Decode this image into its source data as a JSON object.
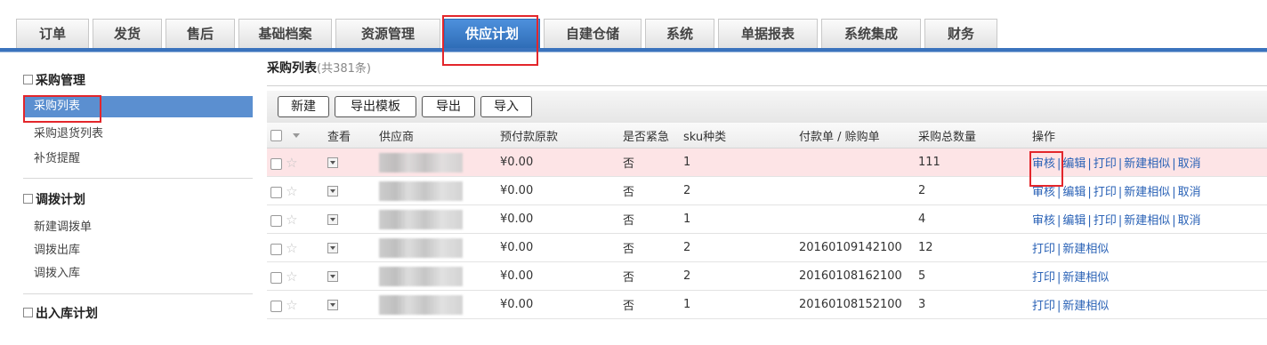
{
  "nav": {
    "tabs": [
      {
        "label": "订单"
      },
      {
        "label": "发货"
      },
      {
        "label": "售后"
      },
      {
        "label": "基础档案"
      },
      {
        "label": "资源管理"
      },
      {
        "label": "供应计划"
      },
      {
        "label": "自建仓储"
      },
      {
        "label": "系统"
      },
      {
        "label": "单据报表"
      },
      {
        "label": "系统集成"
      },
      {
        "label": "财务"
      }
    ],
    "active_tab": "供应计划"
  },
  "sidebar": {
    "sections": [
      {
        "title": "采购管理",
        "items": [
          "采购列表",
          "采购退货列表",
          "补货提醒"
        ]
      },
      {
        "title": "调拨计划",
        "items": [
          "新建调拨单",
          "调拨出库",
          "调拨入库"
        ]
      },
      {
        "title": "出入库计划",
        "items": []
      }
    ],
    "active_item": "采购列表"
  },
  "main": {
    "title": "采购列表",
    "count": "(共381条)",
    "toolbar": {
      "new": "新建",
      "export_template": "导出模板",
      "export": "导出",
      "import": "导入"
    },
    "columns": [
      "查看",
      "供应商",
      "预付款原款",
      "是否紧急",
      "sku种类",
      "付款单 / 赊购单",
      "采购总数量",
      "操作"
    ],
    "rows": [
      {
        "amount": "¥0.00",
        "urgent": "否",
        "sku": "1",
        "payment": "",
        "qty": "111",
        "ops": [
          "审核",
          "编辑",
          "打印",
          "新建相似",
          "取消"
        ]
      },
      {
        "amount": "¥0.00",
        "urgent": "否",
        "sku": "2",
        "payment": "",
        "qty": "2",
        "ops": [
          "审核",
          "编辑",
          "打印",
          "新建相似",
          "取消"
        ]
      },
      {
        "amount": "¥0.00",
        "urgent": "否",
        "sku": "1",
        "payment": "",
        "qty": "4",
        "ops": [
          "审核",
          "编辑",
          "打印",
          "新建相似",
          "取消"
        ]
      },
      {
        "amount": "¥0.00",
        "urgent": "否",
        "sku": "2",
        "payment": "20160109142100",
        "qty": "12",
        "ops": [
          "打印",
          "新建相似"
        ]
      },
      {
        "amount": "¥0.00",
        "urgent": "否",
        "sku": "2",
        "payment": "20160108162100",
        "qty": "5",
        "ops": [
          "打印",
          "新建相似"
        ]
      },
      {
        "amount": "¥0.00",
        "urgent": "否",
        "sku": "1",
        "payment": "20160108152100",
        "qty": "3",
        "ops": [
          "打印",
          "新建相似"
        ]
      }
    ]
  },
  "colors": {
    "accent": "#3a73bd",
    "active_tab": "#2f6db7",
    "highlight_row": "#fde4e6",
    "annotation_red": "#e3262b",
    "link": "#2a62b6"
  }
}
